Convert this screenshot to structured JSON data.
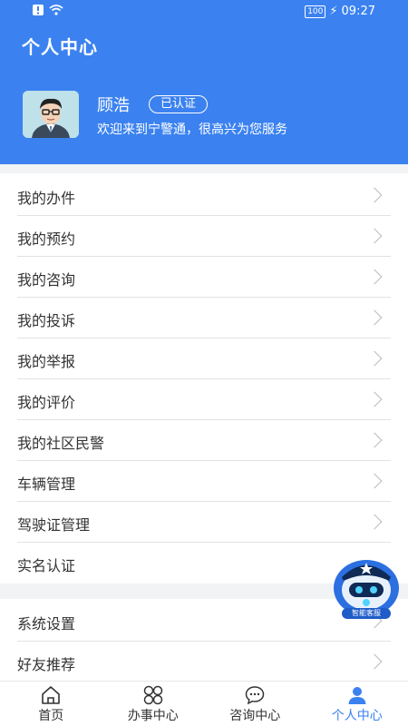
{
  "statusbar": {
    "time": "09:27",
    "battery": "100"
  },
  "header": {
    "title": "个人中心",
    "user_name": "顾浩",
    "badge": "已认证",
    "welcome": "欢迎来到宁警通，很高兴为您服务",
    "accent": "#3b82f0"
  },
  "menu": [
    {
      "label": "我的办件"
    },
    {
      "label": "我的预约"
    },
    {
      "label": "我的咨询"
    },
    {
      "label": "我的投诉"
    },
    {
      "label": "我的举报"
    },
    {
      "label": "我的评价"
    },
    {
      "label": "我的社区民警"
    },
    {
      "label": "车辆管理"
    },
    {
      "label": "驾驶证管理"
    },
    {
      "label": "实名认证"
    }
  ],
  "menu2": [
    {
      "label": "系统设置"
    },
    {
      "label": "好友推荐"
    }
  ],
  "robot": {
    "label": "智能客服"
  },
  "tabbar": [
    {
      "label": "首页",
      "icon": "home-icon"
    },
    {
      "label": "办事中心",
      "icon": "service-grid-icon"
    },
    {
      "label": "咨询中心",
      "icon": "chat-bubble-icon"
    },
    {
      "label": "个人中心",
      "icon": "person-icon",
      "active": true
    }
  ]
}
